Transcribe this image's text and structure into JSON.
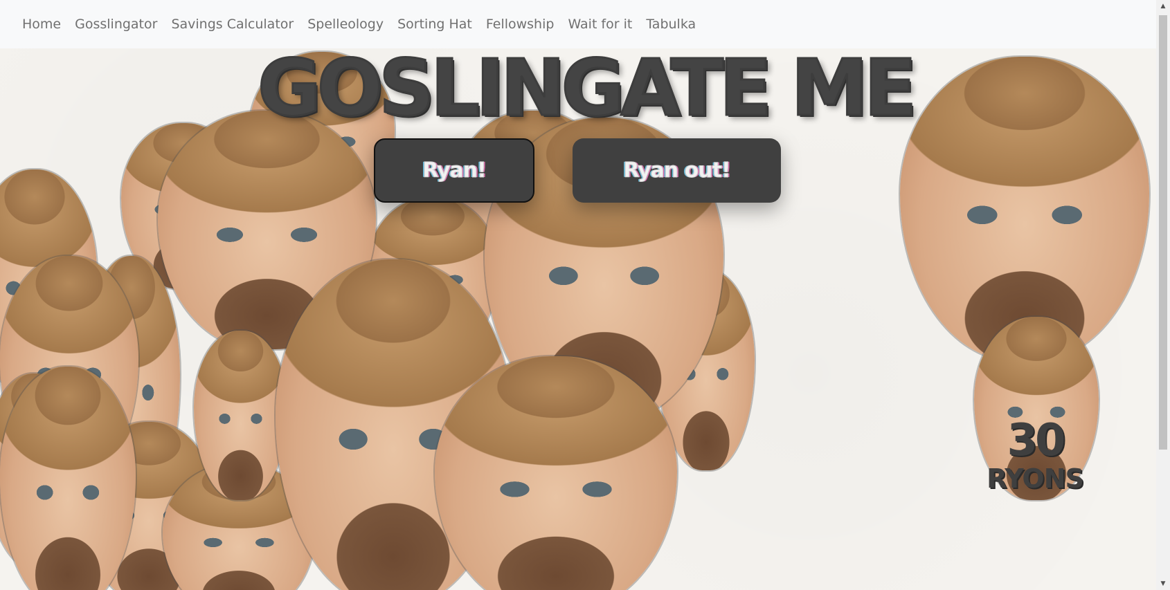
{
  "nav": {
    "items": [
      {
        "label": "Home"
      },
      {
        "label": "Gosslingator"
      },
      {
        "label": "Savings Calculator"
      },
      {
        "label": "Spelleology"
      },
      {
        "label": "Sorting Hat"
      },
      {
        "label": "Fellowship"
      },
      {
        "label": "Wait for it"
      },
      {
        "label": "Tabulka"
      }
    ]
  },
  "main": {
    "title": "GOSLINGATE ME",
    "buttons": {
      "ryan": "Ryan!",
      "ryan_out": "Ryan out!"
    },
    "counter": {
      "count": "30",
      "label": "RYONS"
    }
  },
  "colors": {
    "button_bg": "#404040",
    "title": "#444444",
    "navbar_bg": "#f8f9fa"
  }
}
